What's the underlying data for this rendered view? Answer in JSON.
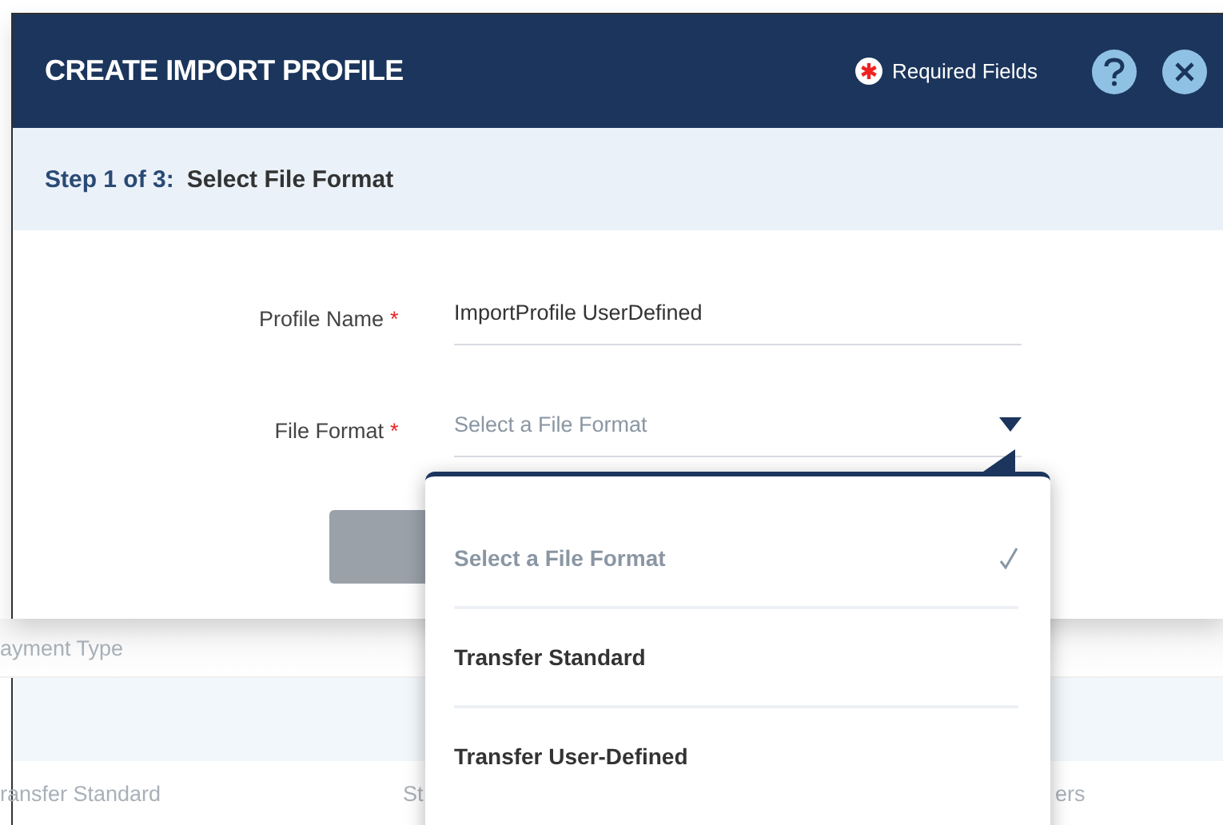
{
  "dialog": {
    "title": "CREATE IMPORT PROFILE",
    "required_note": "Required Fields",
    "step_label": "Step 1 of 3:",
    "step_title": "Select File Format",
    "fields": [
      {
        "label": "Profile Name",
        "required_mark": "*",
        "kind": "text",
        "value": "ImportProfile UserDefined"
      },
      {
        "label": "File Format",
        "required_mark": "*",
        "kind": "select",
        "placeholder": "Select a File Format",
        "expanded": true
      }
    ],
    "options": [
      {
        "label": "Select a File Format",
        "selected": true
      },
      {
        "label": "Transfer Standard",
        "selected": false
      },
      {
        "label": "Transfer User-Defined",
        "selected": false
      }
    ]
  },
  "background_table": {
    "header": [
      "ayment Type"
    ],
    "row": [
      "ransfer Standard",
      "St",
      "ers"
    ]
  }
}
